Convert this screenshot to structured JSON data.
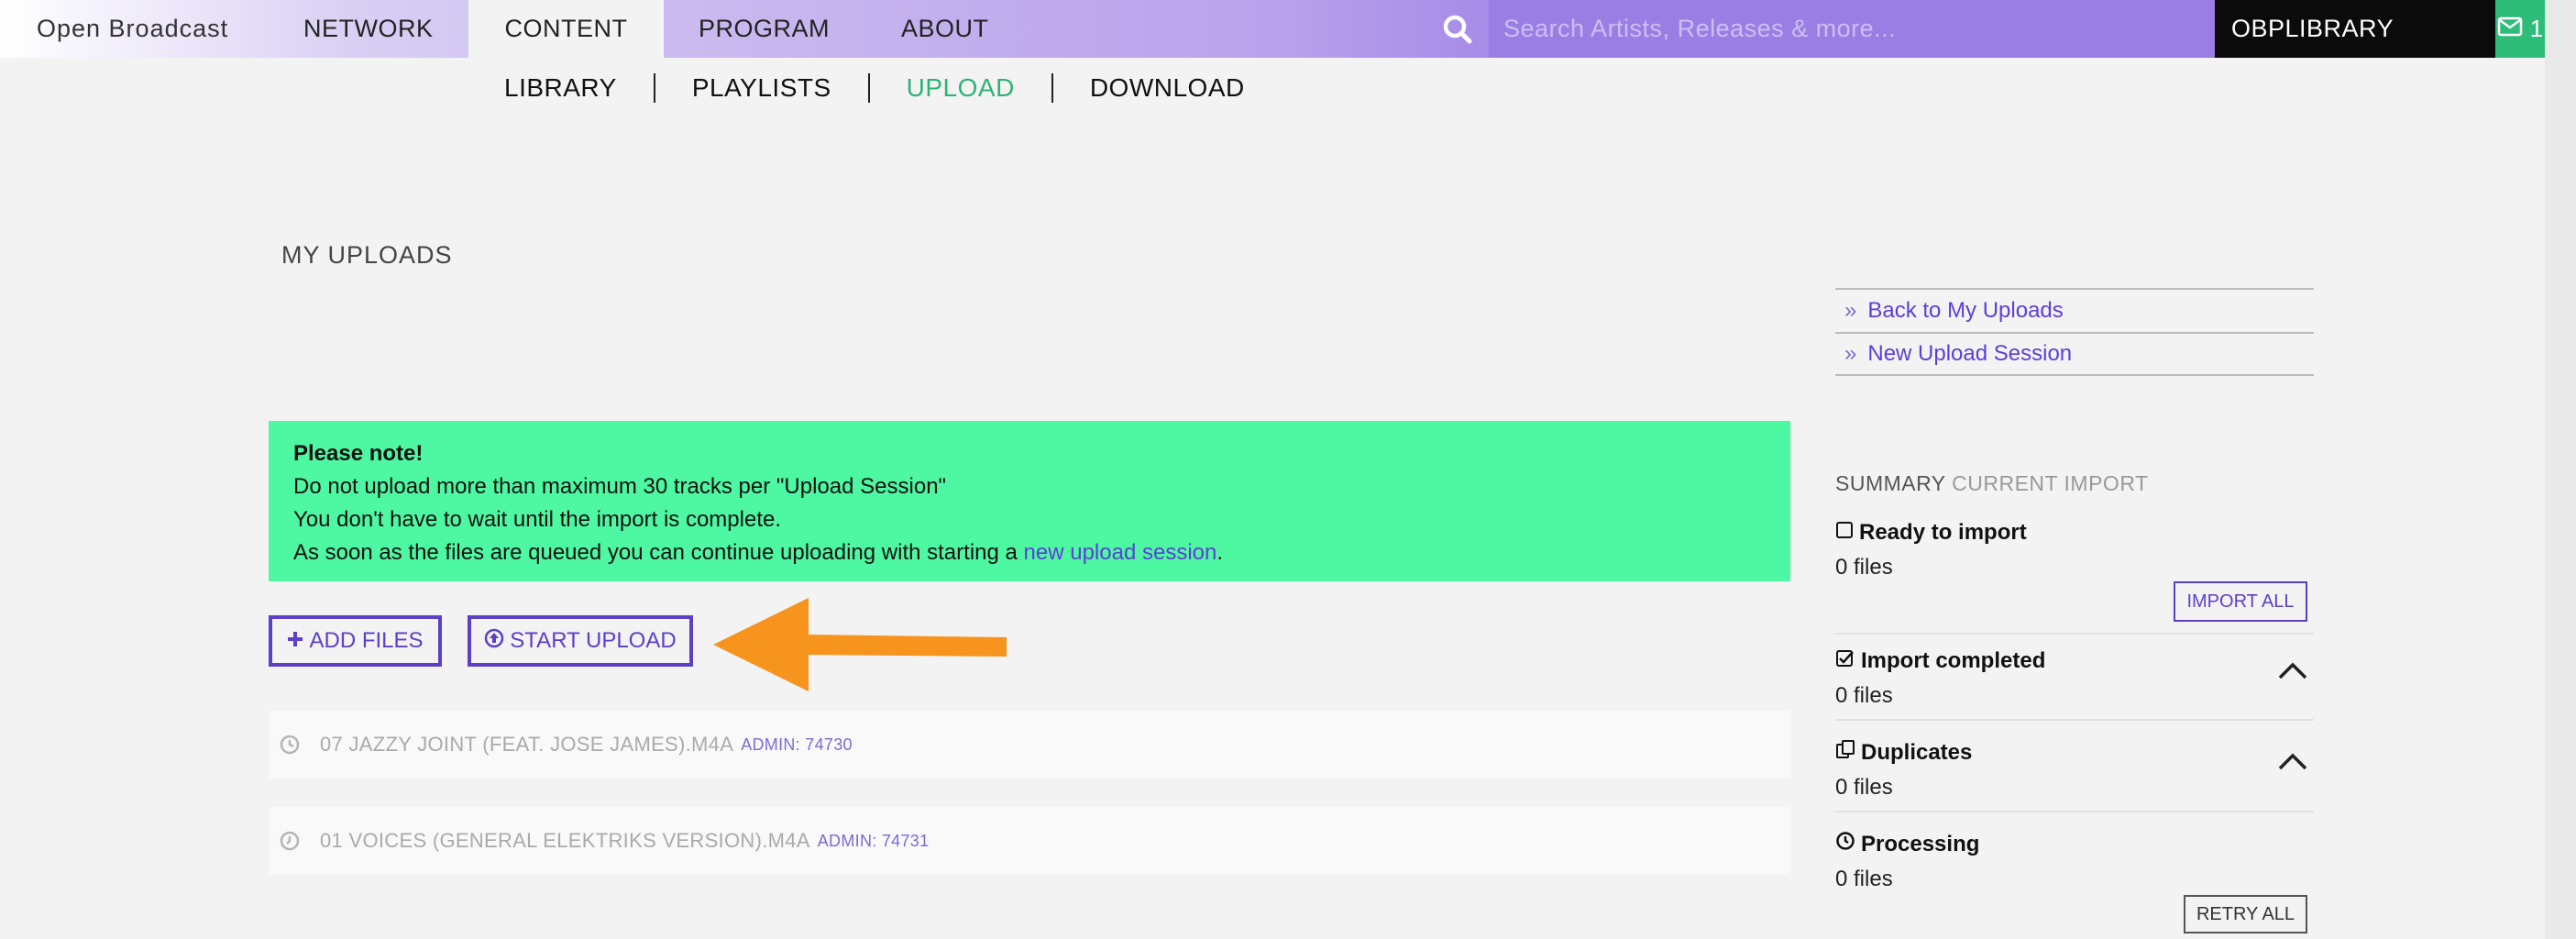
{
  "nav": {
    "brand": "Open Broadcast",
    "items": [
      "NETWORK",
      "CONTENT",
      "PROGRAM",
      "ABOUT"
    ],
    "search_placeholder": "Search Artists, Releases & more...",
    "library_label": "OBPLIBRARY",
    "mail_count": "1"
  },
  "subnav": {
    "items": [
      "LIBRARY",
      "PLAYLISTS",
      "UPLOAD",
      "DOWNLOAD"
    ],
    "active": "UPLOAD"
  },
  "page": {
    "title": "MY UPLOADS"
  },
  "notice": {
    "heading": "Please note!",
    "line1": "Do not upload more than maximum 30 tracks per \"Upload Session\"",
    "line2": "You don't have to wait until the import is complete.",
    "line3_before": "As soon as the files are queued you can continue uploading with starting a ",
    "line3_link": "new upload session",
    "line3_after": "."
  },
  "actions": {
    "add_files": "ADD FILES",
    "start_upload": "START UPLOAD"
  },
  "files": [
    {
      "name": "07 JAZZY JOINT (FEAT. JOSE JAMES).M4A",
      "meta": "ADMIN: 74730"
    },
    {
      "name": "01 VOICES (GENERAL ELEKTRIKS VERSION).M4A",
      "meta": "ADMIN: 74731"
    }
  ],
  "sidebar": {
    "links": [
      "Back to My Uploads",
      "New Upload Session"
    ],
    "summary_title_a": "SUMMARY ",
    "summary_title_b": "CURRENT IMPORT",
    "sections": [
      {
        "title": "Ready to import",
        "count": "0 files",
        "button": "IMPORT ALL"
      },
      {
        "title": "Import completed",
        "count": "0 files"
      },
      {
        "title": "Duplicates",
        "count": "0 files"
      },
      {
        "title": "Processing",
        "count": "0 files",
        "button": "RETRY ALL"
      }
    ]
  },
  "colors": {
    "accent": "#5d3fc8",
    "notice_bg": "#4ef7a1",
    "active_tab": "#2db378",
    "arrow": "#f7941d",
    "mail_bg": "#2dbd79"
  }
}
